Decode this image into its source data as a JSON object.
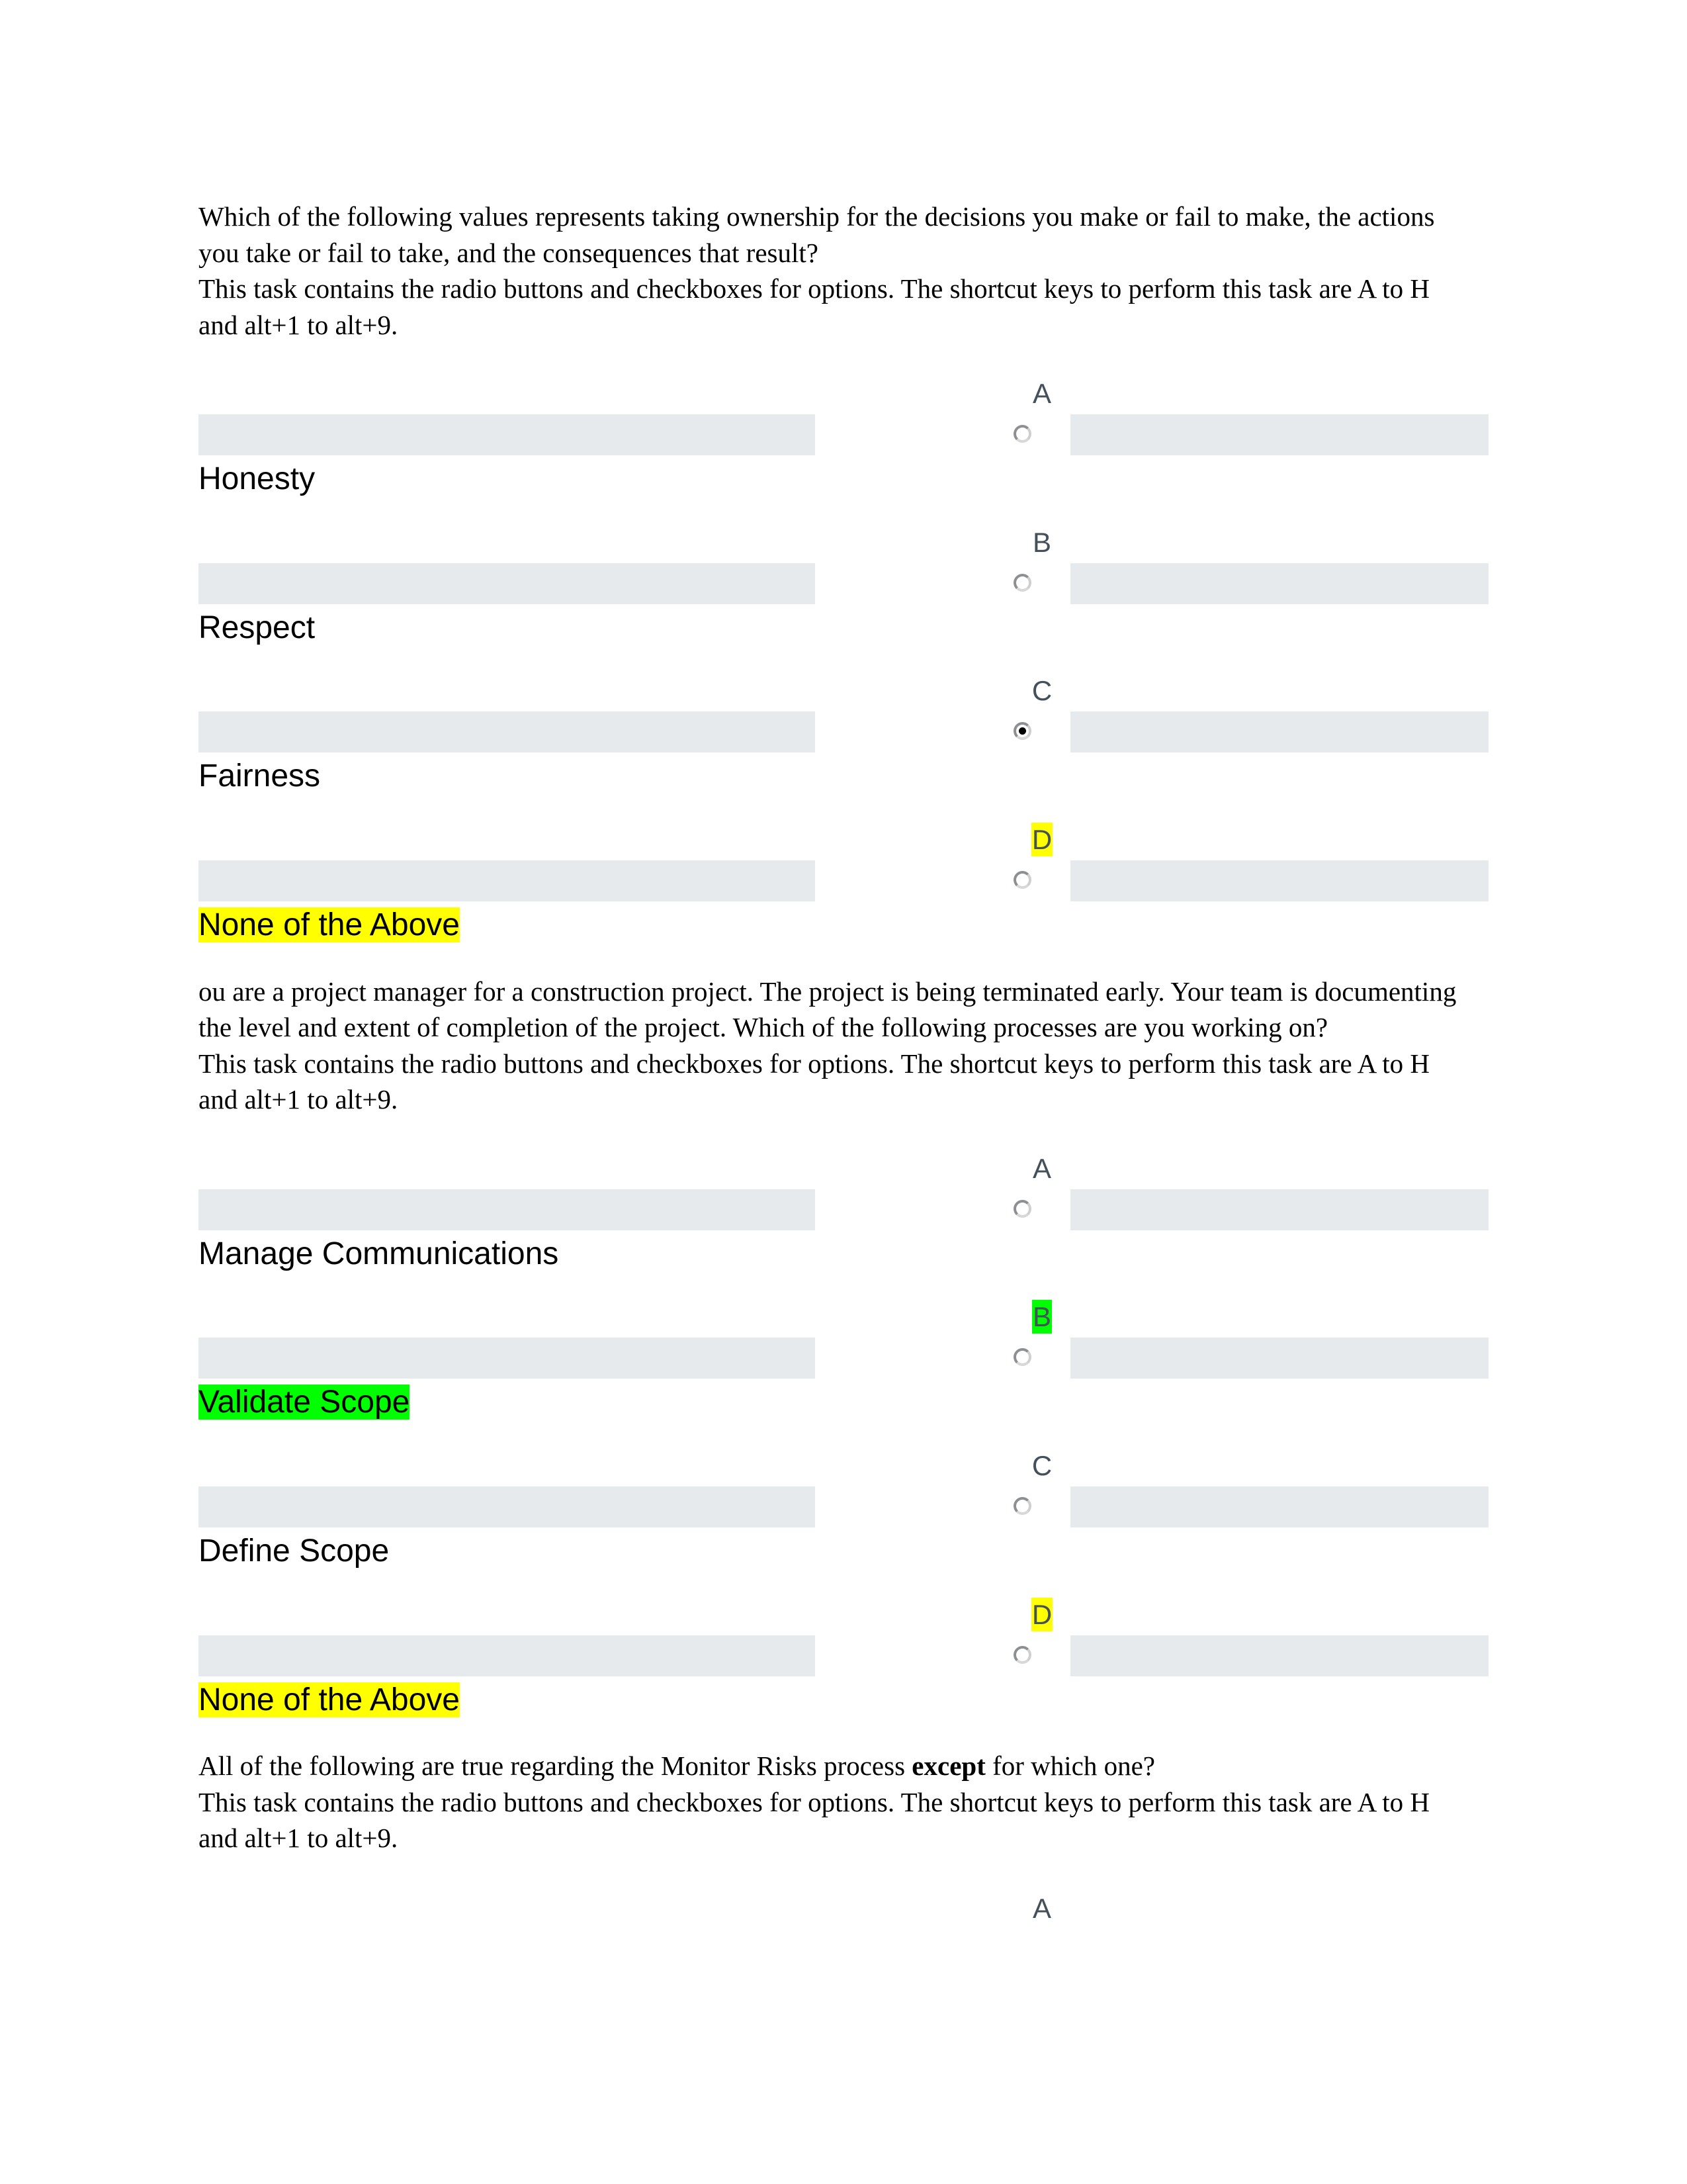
{
  "document": {
    "shared_instruction": "This task contains the radio buttons and checkboxes for options. The shortcut keys to perform this task are A to H and alt+1 to alt+9.",
    "questions": [
      {
        "id": "q1",
        "prompt": "Which of the following values represents taking ownership for the decisions you make or fail to make, the actions you take or fail to take, and the consequences that result?",
        "instruction": "This task contains the radio buttons and checkboxes for options. The shortcut keys to perform this task are A to H and alt+1 to alt+9.",
        "options": [
          {
            "letter": "A",
            "label": "Honesty",
            "selected": false,
            "letter_highlight": "none",
            "label_highlight": "none"
          },
          {
            "letter": "B",
            "label": "Respect",
            "selected": false,
            "letter_highlight": "none",
            "label_highlight": "none"
          },
          {
            "letter": "C",
            "label": "Fairness",
            "selected": true,
            "letter_highlight": "none",
            "label_highlight": "none"
          },
          {
            "letter": "D",
            "label": "None of the Above",
            "selected": false,
            "letter_highlight": "yellow",
            "label_highlight": "yellow"
          }
        ]
      },
      {
        "id": "q2",
        "prompt": "ou are a project manager for a construction project. The project is being terminated early. Your team is documenting the level and extent of completion of the project. Which of the following processes are you working on?",
        "instruction": "This task contains the radio buttons and checkboxes for options. The shortcut keys to perform this task are A to H and alt+1 to alt+9.",
        "options": [
          {
            "letter": "A",
            "label": "Manage Communications",
            "selected": false,
            "letter_highlight": "none",
            "label_highlight": "none"
          },
          {
            "letter": "B",
            "label": "Validate Scope",
            "selected": false,
            "letter_highlight": "green",
            "label_highlight": "green"
          },
          {
            "letter": "C",
            "label": "Define Scope",
            "selected": false,
            "letter_highlight": "none",
            "label_highlight": "none"
          },
          {
            "letter": "D",
            "label": "None of the Above",
            "selected": false,
            "letter_highlight": "yellow",
            "label_highlight": "yellow"
          }
        ]
      },
      {
        "id": "q3",
        "prompt_prefix": "All of the following are true regarding the Monitor Risks process ",
        "prompt_bold": "except",
        "prompt_suffix": " for which one?",
        "instruction": "This task contains the radio buttons and checkboxes for options. The shortcut keys to perform this task are A to H and alt+1 to alt+9.",
        "options": [
          {
            "letter": "A",
            "label": "",
            "selected": false,
            "letter_highlight": "none",
            "label_highlight": "none"
          }
        ]
      }
    ]
  },
  "colors": {
    "option_bar": "#e7eaec",
    "highlight_yellow": "#ffff00",
    "highlight_green": "#00ff00",
    "letter_text": "#44505a",
    "radio_border": "#8d8f92",
    "body_text": "#000000",
    "page_background": "#ffffff"
  },
  "icons": {
    "radio_unselected": "radio-unselected-icon",
    "radio_selected": "radio-selected-icon"
  }
}
